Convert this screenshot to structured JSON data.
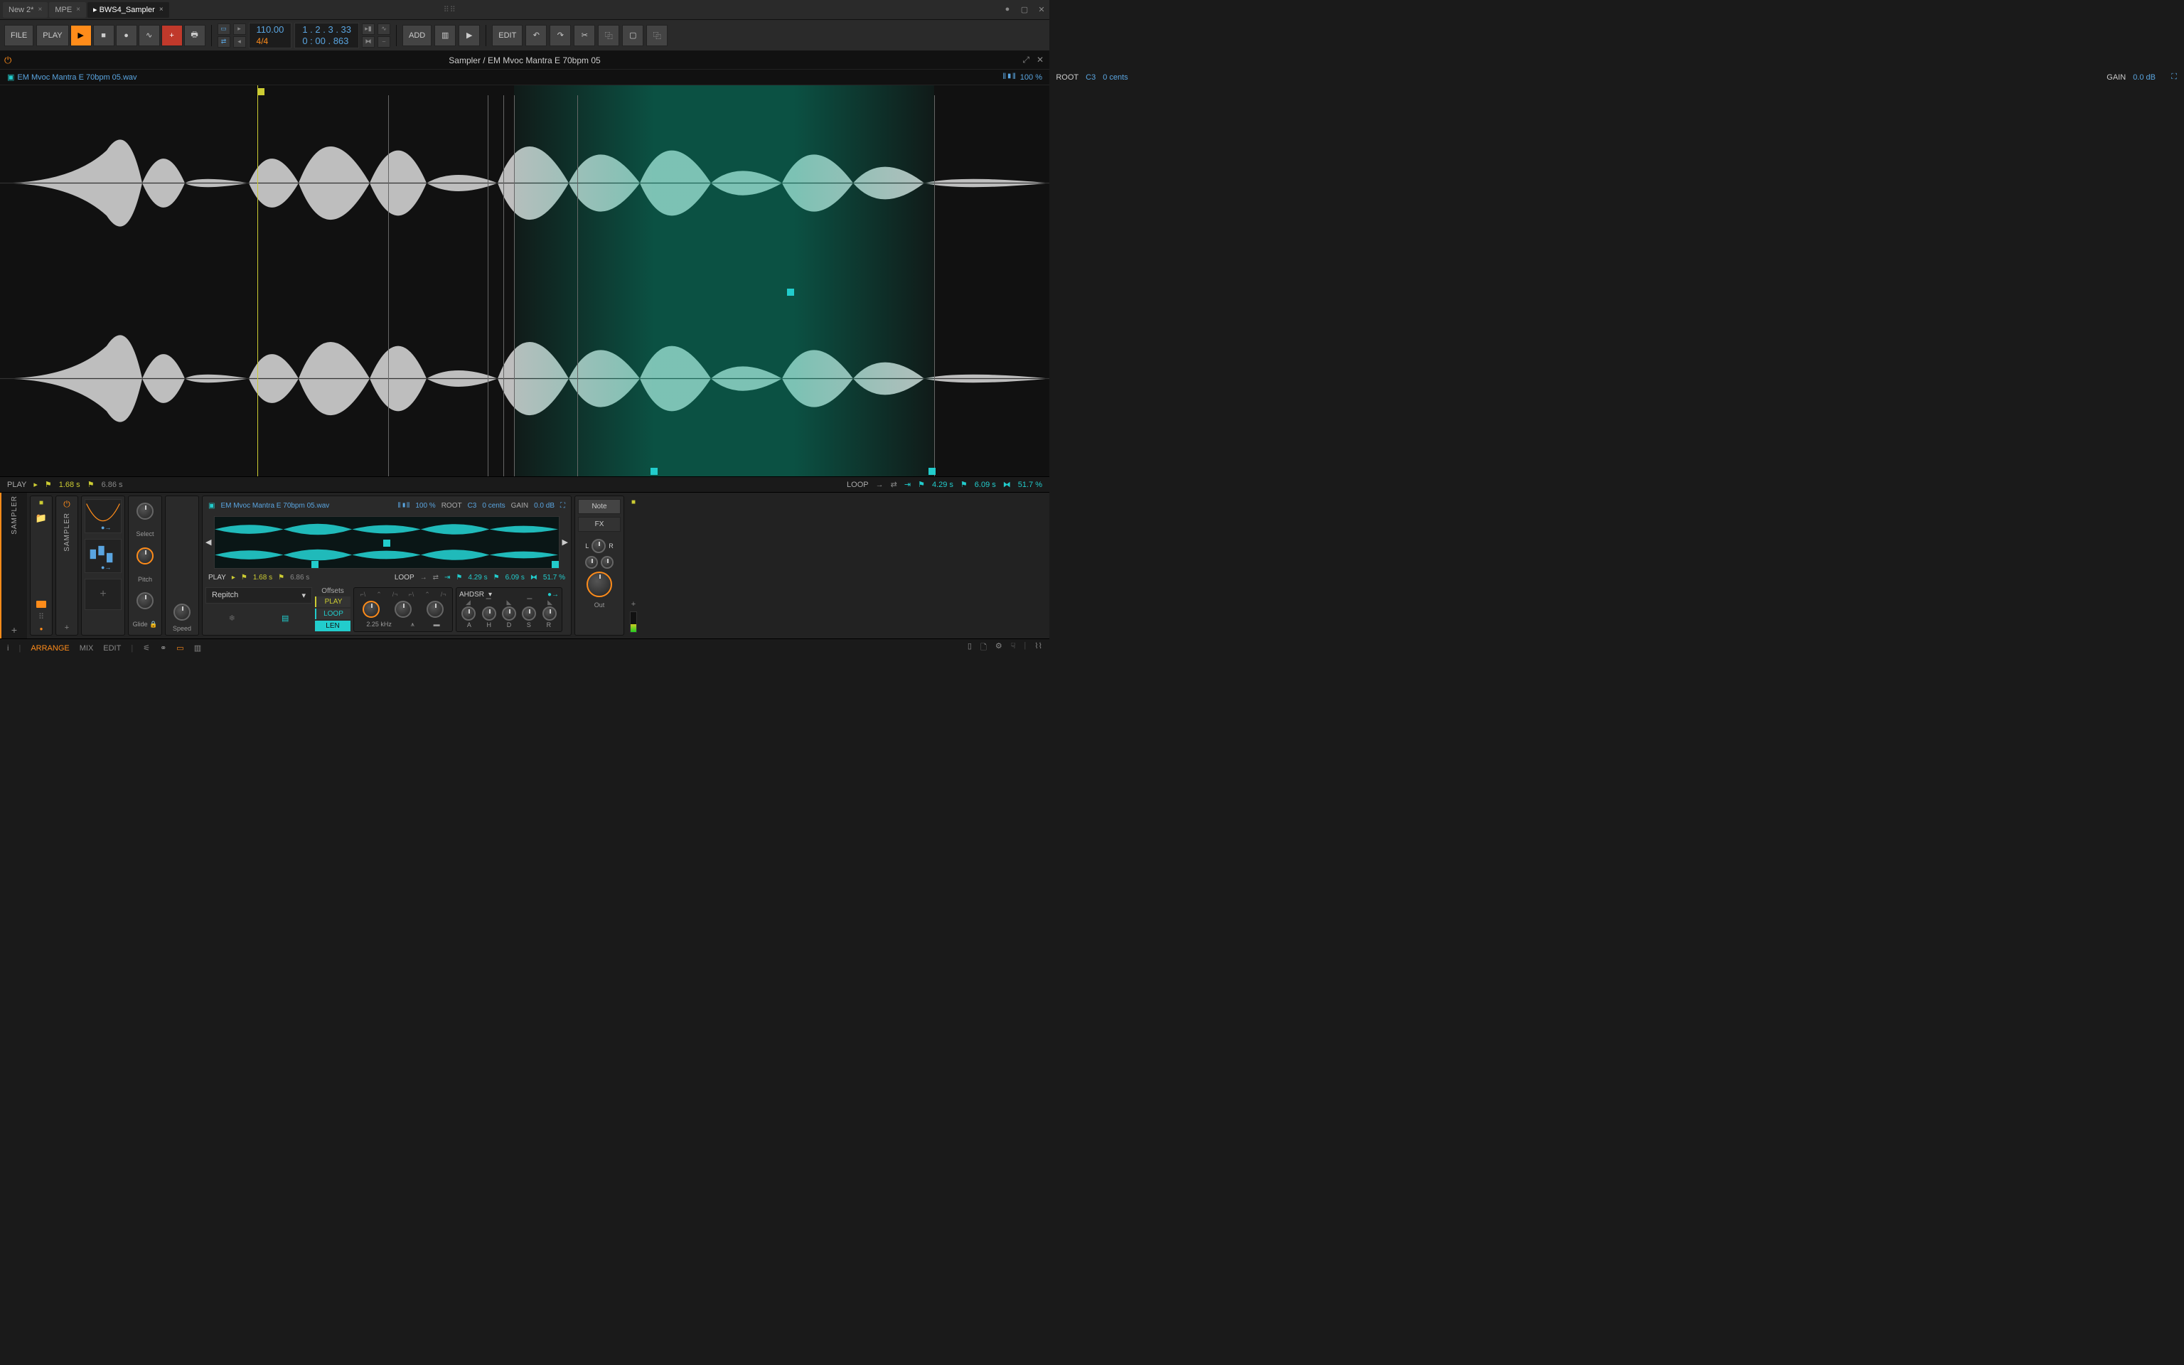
{
  "tabs": [
    {
      "label": "New 2*",
      "active": false
    },
    {
      "label": "MPE",
      "active": false
    },
    {
      "label": "▸  BWS4_Sampler",
      "active": true
    }
  ],
  "toolbar": {
    "file": "FILE",
    "play": "PLAY",
    "add": "ADD",
    "edit": "EDIT",
    "tempo": "110.00",
    "signature": "4/4",
    "position": "1 . 2 . 3 . 33",
    "time": "0 : 00 . 863"
  },
  "sampler": {
    "title": "Sampler / EM Mvoc Mantra E 70bpm 05",
    "filename": "EM Mvoc Mantra E 70bpm 05.wav",
    "zoom": "100 %",
    "root_label": "ROOT",
    "root_note": "C3",
    "root_cents": "0 cents",
    "gain_label": "GAIN",
    "gain_value": "0.0 dB"
  },
  "playbar": {
    "play_label": "PLAY",
    "play_start": "1.68 s",
    "play_end": "6.86 s",
    "loop_label": "LOOP",
    "loop_start": "4.29 s",
    "loop_end": "6.09 s",
    "loop_xfade": "51.7 %"
  },
  "device": {
    "sampler_label": "SAMPLER",
    "select": "Select",
    "pitch": "Pitch",
    "glide": "Glide",
    "speed": "Speed",
    "repitch": "Repitch",
    "offsets": "Offsets",
    "offset_play": "PLAY",
    "offset_loop": "LOOP",
    "offset_len": "LEN",
    "filter_freq": "2.25 kHz",
    "ahdsr": "AHDSR",
    "env_a": "A",
    "env_h": "H",
    "env_d": "D",
    "env_s": "S",
    "env_r": "R",
    "note": "Note",
    "fx": "FX",
    "pan_l": "L",
    "pan_r": "R",
    "out": "Out",
    "mini_zoom": "100 %",
    "mini_root": "ROOT",
    "mini_note": "C3",
    "mini_cents": "0 cents",
    "mini_gain": "GAIN",
    "mini_gain_val": "0.0 dB",
    "mini_play": "PLAY",
    "mini_play_start": "1.68 s",
    "mini_play_end": "6.86 s",
    "mini_loop": "LOOP",
    "mini_loop_start": "4.29 s",
    "mini_loop_end": "6.09 s",
    "mini_loop_xf": "51.7 %"
  },
  "footer": {
    "arrange": "ARRANGE",
    "mix": "MIX",
    "edit": "EDIT"
  }
}
